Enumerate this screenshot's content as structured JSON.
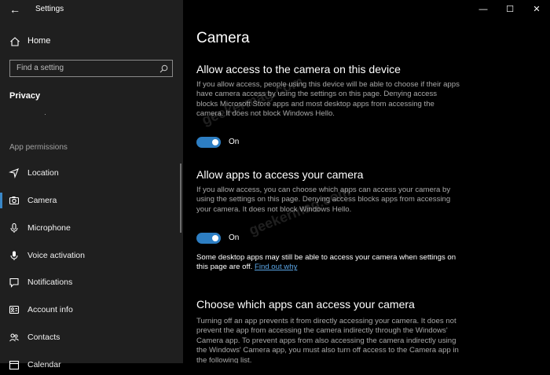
{
  "window": {
    "title": "Settings",
    "minimize": "—",
    "maximize": "☐",
    "close": "✕",
    "back": "←"
  },
  "sidebar": {
    "home": "Home",
    "search_placeholder": "Find a setting",
    "category": "Privacy",
    "section_label": "App permissions",
    "items": [
      {
        "label": "Location",
        "icon": "location-icon"
      },
      {
        "label": "Camera",
        "icon": "camera-icon",
        "active": true
      },
      {
        "label": "Microphone",
        "icon": "microphone-icon"
      },
      {
        "label": "Voice activation",
        "icon": "voice-activation-icon"
      },
      {
        "label": "Notifications",
        "icon": "notifications-icon"
      },
      {
        "label": "Account info",
        "icon": "account-info-icon"
      },
      {
        "label": "Contacts",
        "icon": "contacts-icon"
      },
      {
        "label": "Calendar",
        "icon": "calendar-icon"
      }
    ]
  },
  "main": {
    "title": "Camera",
    "device_section": {
      "heading": "Allow access to the camera on this device",
      "description": "If you allow access, people using this device will be able to choose if their apps have camera access by using the settings on this page. Denying access blocks Microsoft Store apps and most desktop apps from accessing the camera. It does not block Windows Hello.",
      "toggle_label": "On"
    },
    "apps_section": {
      "heading": "Allow apps to access your camera",
      "description": "If you allow access, you can choose which apps can access your camera by using the settings on this page. Denying access blocks apps from accessing your camera. It does not block Windows Hello.",
      "toggle_label": "On",
      "note": "Some desktop apps may still be able to access your camera when settings on this page are off.",
      "note_link": "Find out why"
    },
    "choose_section": {
      "heading": "Choose which apps can access your camera",
      "description": "Turning off an app prevents it from directly accessing your camera. It does not prevent the app from accessing the camera indirectly through the Windows' Camera app. To prevent apps from also accessing the camera indirectly using the Windows' Camera app, you must also turn off access to the Camera app in the following list."
    }
  },
  "watermark": "geekermag.com",
  "colors": {
    "accent": "#2d7ec3",
    "link": "#5ba6e6",
    "sidebar_bg": "#1f1f1f",
    "main_bg": "#000000"
  }
}
